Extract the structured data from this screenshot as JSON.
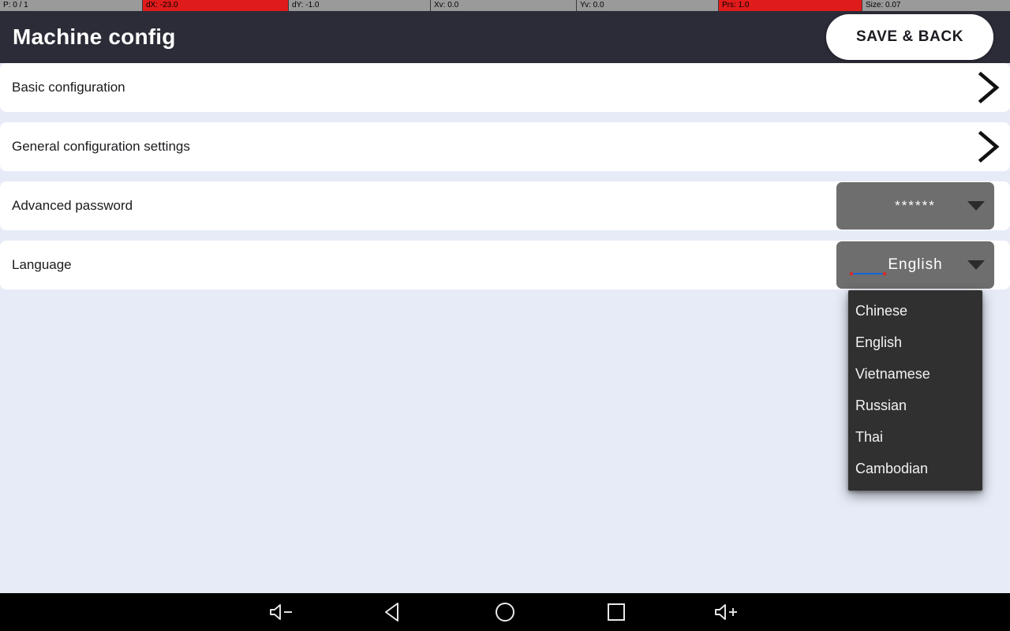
{
  "statusbar": {
    "cells": [
      {
        "text": "P: 0 / 1",
        "alert": false
      },
      {
        "text": "dX: -23.0",
        "alert": true
      },
      {
        "text": "dY: -1.0",
        "alert": false
      },
      {
        "text": "Xv: 0.0",
        "alert": false
      },
      {
        "text": "Yv: 0.0",
        "alert": false
      },
      {
        "text": "Prs: 1.0",
        "alert": true
      },
      {
        "text": "Size: 0.07",
        "alert": false
      }
    ],
    "alert_color": "#e01b1b",
    "background": "#9a9a9a"
  },
  "header": {
    "title": "Machine config",
    "save_button_label": "SAVE & BACK",
    "background": "#2c2c38"
  },
  "rows": [
    {
      "label": "Basic configuration",
      "type": "navigation",
      "icon": "chevron-right-icon",
      "name": "row-basic-configuration"
    },
    {
      "label": "General configuration settings",
      "type": "navigation",
      "icon": "chevron-right-icon",
      "name": "row-general-configuration-settings"
    },
    {
      "label": "Advanced password",
      "type": "spinner",
      "value": "******",
      "name": "row-advanced-password"
    },
    {
      "label": "Language",
      "type": "spinner",
      "value": "English",
      "name": "row-language"
    }
  ],
  "language_popup": {
    "open": true,
    "selected": "English",
    "options": [
      "Chinese",
      "English",
      "Vietnamese",
      "Russian",
      "Thai",
      "Cambodian"
    ],
    "background": "#303030"
  },
  "navbar": {
    "buttons": [
      {
        "name": "volume-down-icon",
        "label": "Volume down"
      },
      {
        "name": "back-icon",
        "label": "Back"
      },
      {
        "name": "home-icon",
        "label": "Home"
      },
      {
        "name": "recents-icon",
        "label": "Recent apps"
      },
      {
        "name": "volume-up-icon",
        "label": "Volume up"
      }
    ]
  }
}
